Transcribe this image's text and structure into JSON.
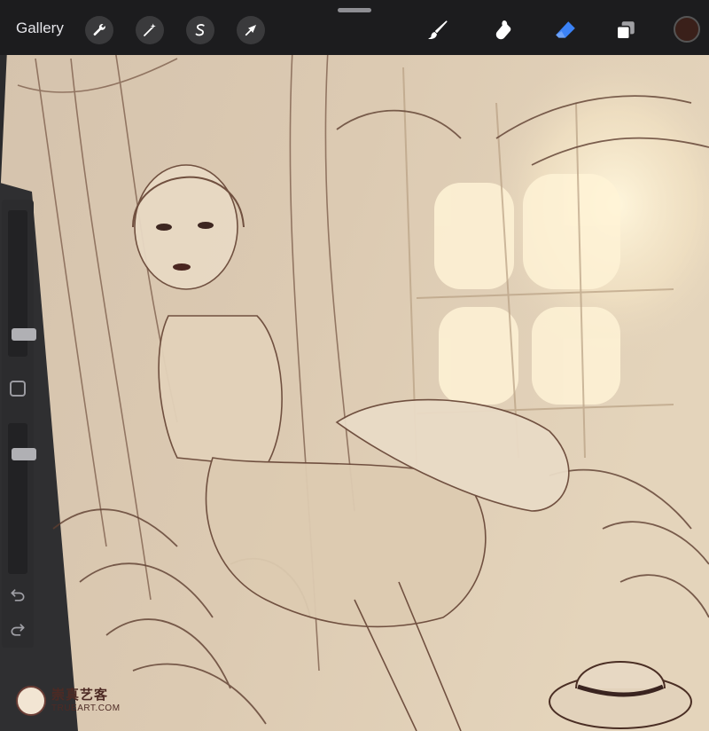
{
  "app": {
    "gallery_label": "Gallery"
  },
  "toolbar": {
    "left_tools": [
      {
        "name": "actions",
        "icon": "wrench-icon"
      },
      {
        "name": "adjustments",
        "icon": "magic-wand-icon"
      },
      {
        "name": "selection",
        "icon": "selection-s-icon"
      },
      {
        "name": "transform",
        "icon": "arrow-cursor-icon"
      }
    ],
    "right_tools": [
      {
        "name": "brush",
        "icon": "brush-icon",
        "active": false
      },
      {
        "name": "smudge",
        "icon": "smudge-icon",
        "active": false
      },
      {
        "name": "eraser",
        "icon": "eraser-icon",
        "active": true
      },
      {
        "name": "layers",
        "icon": "layers-icon",
        "active": false
      }
    ],
    "current_color": "#3a201a",
    "active_color": "#3b82f6"
  },
  "sidebar": {
    "brush_size_level": 0.12,
    "brush_opacity_level": 0.82
  },
  "watermark": {
    "cn": "崇真艺客",
    "en": "TRUEART.COM"
  }
}
